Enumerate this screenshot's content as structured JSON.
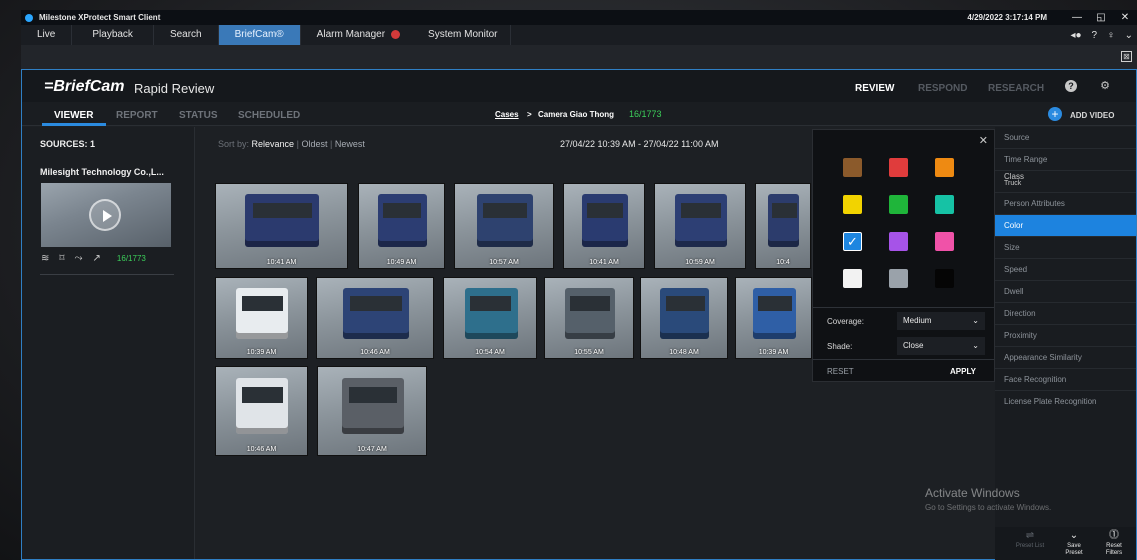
{
  "titlebar": {
    "app_title": "Milestone XProtect Smart Client",
    "clock": "4/29/2022 3:17:14 PM",
    "minimize": "—",
    "restore": "◱",
    "close": "✕"
  },
  "tabs": [
    {
      "label": "Live"
    },
    {
      "label": "Playback"
    },
    {
      "label": "Search"
    },
    {
      "label": "BriefCam®"
    },
    {
      "label": "Alarm Manager"
    },
    {
      "label": "System Monitor"
    }
  ],
  "tabbar_icons": {
    "back": "◂●",
    "help": "?",
    "user": "♀",
    "more": "⌄"
  },
  "subbar": {
    "expand_icon": "⊠"
  },
  "header": {
    "brand": "=BriefCam",
    "product": "Rapid Review",
    "modes": [
      "REVIEW",
      "RESPOND",
      "RESEARCH"
    ],
    "help_icon": "?",
    "settings_icon": "⚙"
  },
  "nav": {
    "items": [
      "VIEWER",
      "REPORT",
      "STATUS",
      "SCHEDULED"
    ],
    "breadcrumb_cases": "Cases",
    "breadcrumb_sep": ">",
    "breadcrumb_camera": "Camera Giao Thong",
    "breadcrumb_count": "16/1773",
    "add_video": "ADD VIDEO",
    "add_icon": "+"
  },
  "sources": {
    "title": "SOURCES: 1",
    "name": "Milesight Technology Co.,L...",
    "count": "16/1773",
    "tool_icons": [
      "≋",
      "⌑",
      "⤳",
      "↗"
    ]
  },
  "sort": {
    "prefix": "Sort by:",
    "selected": "Relevance",
    "sep": "|",
    "options": [
      "Oldest",
      "Newest"
    ]
  },
  "date_range": "27/04/22 10:39 AM - 27/04/22 11:00 AM",
  "results": [
    {
      "time": "10:41 AM",
      "color": "#2b3a6e"
    },
    {
      "time": "10:49 AM",
      "color": "#2c3d72"
    },
    {
      "time": "10:57 AM",
      "color": "#2e426f"
    },
    {
      "time": "10:41 AM",
      "color": "#2a3b70"
    },
    {
      "time": "10:59 AM",
      "color": "#2d3f74"
    },
    {
      "time": "10:4",
      "color": "#2c3c6c"
    },
    {
      "time": "10:39 AM",
      "color": "#e8ecef"
    },
    {
      "time": "10:46 AM",
      "color": "#2d4476"
    },
    {
      "time": "10:54 AM",
      "color": "#2e6f8c"
    },
    {
      "time": "10:55 AM",
      "color": "#55606a"
    },
    {
      "time": "10:48 AM",
      "color": "#2a4a7a"
    },
    {
      "time": "10:39 AM",
      "color": "#2f5fa6"
    },
    {
      "time": "10:46 AM",
      "color": "#e0e4e8"
    },
    {
      "time": "10:47 AM",
      "color": "#5a5f66"
    }
  ],
  "color_popup": {
    "close_icon": "✕",
    "swatches": [
      "#8b5a2b",
      "#e03c3c",
      "#ee8a12",
      "#f2d300",
      "#1fb53a",
      "#16c2a5",
      "#1e86e0",
      "#a653e8",
      "#f052a8",
      "#f2f2f2",
      "#9aa2aa",
      "#050505"
    ],
    "checked_index": 6,
    "check_mark": "✓",
    "coverage_label": "Coverage:",
    "coverage_value": "Medium",
    "shade_label": "Shade:",
    "shade_value": "Close",
    "chevron": "⌄",
    "reset": "RESET",
    "apply": "APPLY"
  },
  "filters": {
    "items": [
      "Source",
      "Time Range",
      "Class",
      "Person Attributes",
      "Color",
      "Size",
      "Speed",
      "Dwell",
      "Direction",
      "Proximity",
      "Appearance Similarity",
      "Face Recognition",
      "License Plate Recognition"
    ],
    "class_sub": "Truck",
    "active": "Color"
  },
  "bottom_buttons": [
    {
      "icon": "⇌",
      "label": "Preset List"
    },
    {
      "icon": "⌄",
      "label": "Save Preset"
    },
    {
      "icon": "⓵",
      "label": "Reset Filters"
    }
  ],
  "watermark": {
    "line1": "Activate Windows",
    "line2": "Go to Settings to activate Windows."
  }
}
